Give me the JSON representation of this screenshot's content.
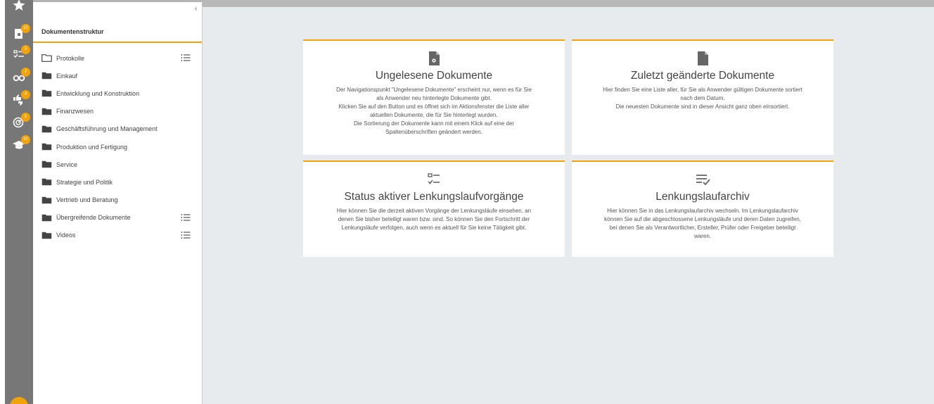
{
  "sidebar": {
    "items": [
      {
        "icon": "star-icon",
        "badge": ""
      },
      {
        "icon": "document-lock-icon",
        "badge": "10"
      },
      {
        "icon": "task-list-icon",
        "badge": "3"
      },
      {
        "icon": "glasses-icon",
        "badge": "2"
      },
      {
        "icon": "thumbs-icon",
        "badge": "4"
      },
      {
        "icon": "target-icon",
        "badge": "5"
      },
      {
        "icon": "graduation-cap-icon",
        "badge": "10"
      }
    ],
    "accent_color": "#f0a30a"
  },
  "tree": {
    "collapse_glyph": "‹",
    "title": "Dokumentenstruktur",
    "items": [
      {
        "label": "Protokolle",
        "folder": "outline",
        "has_list": true
      },
      {
        "label": "Einkauf",
        "folder": "filled",
        "has_list": false
      },
      {
        "label": "Entwicklung und Konstruktion",
        "folder": "filled",
        "has_list": false
      },
      {
        "label": "Finanzwesen",
        "folder": "filled",
        "has_list": false
      },
      {
        "label": "Geschäftsführung und Management",
        "folder": "filled",
        "has_list": false
      },
      {
        "label": "Produktion und Fertigung",
        "folder": "filled",
        "has_list": false
      },
      {
        "label": "Service",
        "folder": "filled",
        "has_list": false
      },
      {
        "label": "Strategie und Politik",
        "folder": "filled",
        "has_list": false
      },
      {
        "label": "Vertrieb und Beratung",
        "folder": "filled",
        "has_list": false
      },
      {
        "label": "Übergreifende Dokumente",
        "folder": "filled",
        "has_list": true
      },
      {
        "label": "Videos",
        "folder": "filled",
        "has_list": true
      }
    ]
  },
  "cards": {
    "unread": {
      "icon": "document-gear-icon",
      "title": "Ungelesene Dokumente",
      "lines": [
        "Der Navigationspunkt \"Ungelesene Dokumente\" erscheint nur, wenn es für Sie",
        "als Anwender neu hinterlegte Dokumente gibt.",
        "Klicken Sie auf den Button und es öffnet sich im Aktionsfenster die Liste aller",
        "aktuellen Dokumente, die für Sie hinterlegt wurden.",
        "Die Sortierung der Dokumente kann mit einem Klick auf eine der",
        "Spaltenüberschriften geändert werden."
      ]
    },
    "changed": {
      "icon": "document-icon",
      "title": "Zuletzt geänderte Dokumente",
      "lines": [
        "Hier finden Sie eine Liste aller, für Sie als Anwender gültigen Dokumente sortiert",
        "nach dem Datum.",
        "Die neuesten Dokumente sind in dieser Ansicht ganz oben einsortiert."
      ]
    },
    "status": {
      "icon": "task-checklist-icon",
      "title": "Status aktiver Lenkungslaufvorgänge",
      "lines": [
        "Hier können Sie die derzeit aktiven Vorgänge der Lenkungsläufe einsehen, an",
        "denen Sie bisher beteiligt waren bzw. sind. So können Sie den Fortschritt der",
        "Lenkungsläufe verfolgen, auch wenn es aktuell für Sie keine Tätigkeit gibt."
      ]
    },
    "archive": {
      "icon": "list-check-icon",
      "title": "Lenkungslaufarchiv",
      "lines": [
        "Hier können Sie in das Lenkungslaufarchiv wechseln. Im Lenkungslaufarchiv",
        "können Sie auf die abgeschlossene Lenkungsläufe und deren Daten zugreifen,",
        "bei denen Sie als Verantwortlicher, Ersteller, Prüfer oder Freigeber beteiligt",
        "waren."
      ]
    }
  }
}
